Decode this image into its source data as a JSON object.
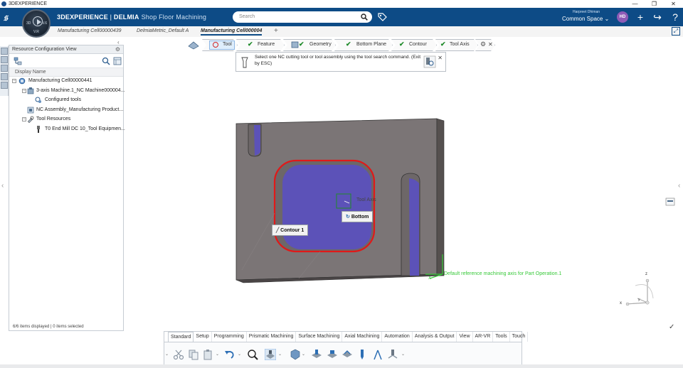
{
  "window": {
    "title": "3DEXPERIENCE",
    "minimize": "—",
    "maximize": "❐",
    "close": "✕"
  },
  "header": {
    "brand_3dx": "3DEXPERIENCE",
    "brand_sep": " | ",
    "brand_company": "DELMIA",
    "app_name": "Shop Floor Machining",
    "search_placeholder": "Search",
    "user_name": "Harpreet Dhiman",
    "collab_space": "Common Space",
    "avatar_initials": "HD",
    "compass_version": "V.R",
    "compass_left": "3D",
    "compass_right": "V.6"
  },
  "tabs": [
    {
      "label": "Manufacturing Cell00000439"
    },
    {
      "label": "DelmiaMetric_Default A"
    },
    {
      "label": "Manufacturing Cell000004"
    }
  ],
  "resource_panel": {
    "title": "Resource Configuration View",
    "column_header": "Display Name",
    "tree": [
      {
        "label": "Manufacturing Cell00000441"
      },
      {
        "label": "3-axis Machine.1_NC Machine000004..."
      },
      {
        "label": "Configured tools"
      },
      {
        "label": "NC Assembly_Manufacturing Product..."
      },
      {
        "label": "Tool Resources"
      },
      {
        "label": "T0 End Mill DC 10_Tool Equipmen..."
      }
    ],
    "status": "6/6 items displayed | 0 items selected"
  },
  "machining_toolbar": {
    "steps": [
      {
        "label": "Tool"
      },
      {
        "label": "Feature"
      },
      {
        "label": "Geometry"
      },
      {
        "label": "Bottom Plane"
      },
      {
        "label": "Contour"
      },
      {
        "label": "Tool Axis"
      }
    ],
    "prompt": "Select one NC cutting tool or tool assembly using the tool search command. (Exit by ESC)"
  },
  "viewport_labels": {
    "tool_axis": "Tool Axis",
    "bottom": "Bottom",
    "contour": "Contour 1",
    "reference_axis": "Default reference machining axis for Part Operation.1",
    "axis_x": "x",
    "axis_y": "y",
    "axis_z": "z",
    "axis_x2": "X"
  },
  "bottom_toolbar": {
    "tabs": [
      {
        "label": "Standard"
      },
      {
        "label": "Setup"
      },
      {
        "label": "Programming"
      },
      {
        "label": "Prismatic Machining"
      },
      {
        "label": "Surface Machining"
      },
      {
        "label": "Axial Machining"
      },
      {
        "label": "Automation"
      },
      {
        "label": "Analysis & Output"
      },
      {
        "label": "View"
      },
      {
        "label": "AR-VR"
      },
      {
        "label": "Tools"
      },
      {
        "label": "Touch"
      }
    ],
    "active_tab": "Standard"
  },
  "colors": {
    "header_blue": "#0d4b86",
    "pocket_purple": "#5c52b8",
    "contour_red": "#e01919",
    "part_gray": "#7a7475",
    "check_green": "#1f8a2a"
  }
}
